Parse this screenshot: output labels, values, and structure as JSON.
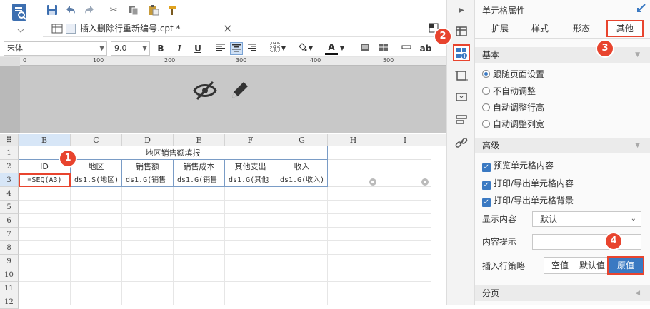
{
  "file_tab": {
    "title": "插入删除行重新编号.cpt *",
    "close": "×"
  },
  "format": {
    "font": "宋体",
    "size": "9.0",
    "bold": "B",
    "italic": "I",
    "underline": "U",
    "text_color": "A",
    "ab": "ab"
  },
  "ruler": {
    "ticks": [
      "0",
      "100",
      "200",
      "300",
      "400",
      "500"
    ]
  },
  "grid": {
    "columns": [
      "B",
      "C",
      "D",
      "E",
      "F",
      "G",
      "H",
      "I"
    ],
    "rows": [
      "1",
      "2",
      "3",
      "4",
      "5",
      "6",
      "7",
      "8",
      "9",
      "10",
      "11",
      "12"
    ],
    "title": "地区销售额填报",
    "headers": [
      "ID",
      "地区",
      "销售额",
      "销售成本",
      "其他支出",
      "收入"
    ],
    "data_row": [
      "=SEQ(A3)",
      "ds1.S(地区)",
      "ds1.G(销售",
      "ds1.G(销售",
      "ds1.G(其他",
      "ds1.G(收入)"
    ]
  },
  "panel": {
    "title": "单元格属性",
    "tabs": [
      "扩展",
      "样式",
      "形态",
      "其他"
    ],
    "basic": {
      "label": "基本",
      "options": [
        "跟随页面设置",
        "不自动调整",
        "自动调整行高",
        "自动调整列宽"
      ],
      "selected": 0
    },
    "advanced": {
      "label": "高级",
      "checks": [
        "预览单元格内容",
        "打印/导出单元格内容",
        "打印/导出单元格背景"
      ],
      "display_label": "显示内容",
      "display_value": "默认",
      "tooltip_label": "内容提示",
      "tooltip_value": "",
      "insert_label": "插入行策略",
      "insert_options": [
        "空值",
        "默认值",
        "原值"
      ],
      "insert_selected": 2
    },
    "paging": {
      "label": "分页"
    }
  },
  "badges": [
    "1",
    "2",
    "3",
    "4"
  ],
  "colors": {
    "accent": "#3a79c2",
    "badge": "#e8442e",
    "selected_tab_border": "#e8442e"
  }
}
